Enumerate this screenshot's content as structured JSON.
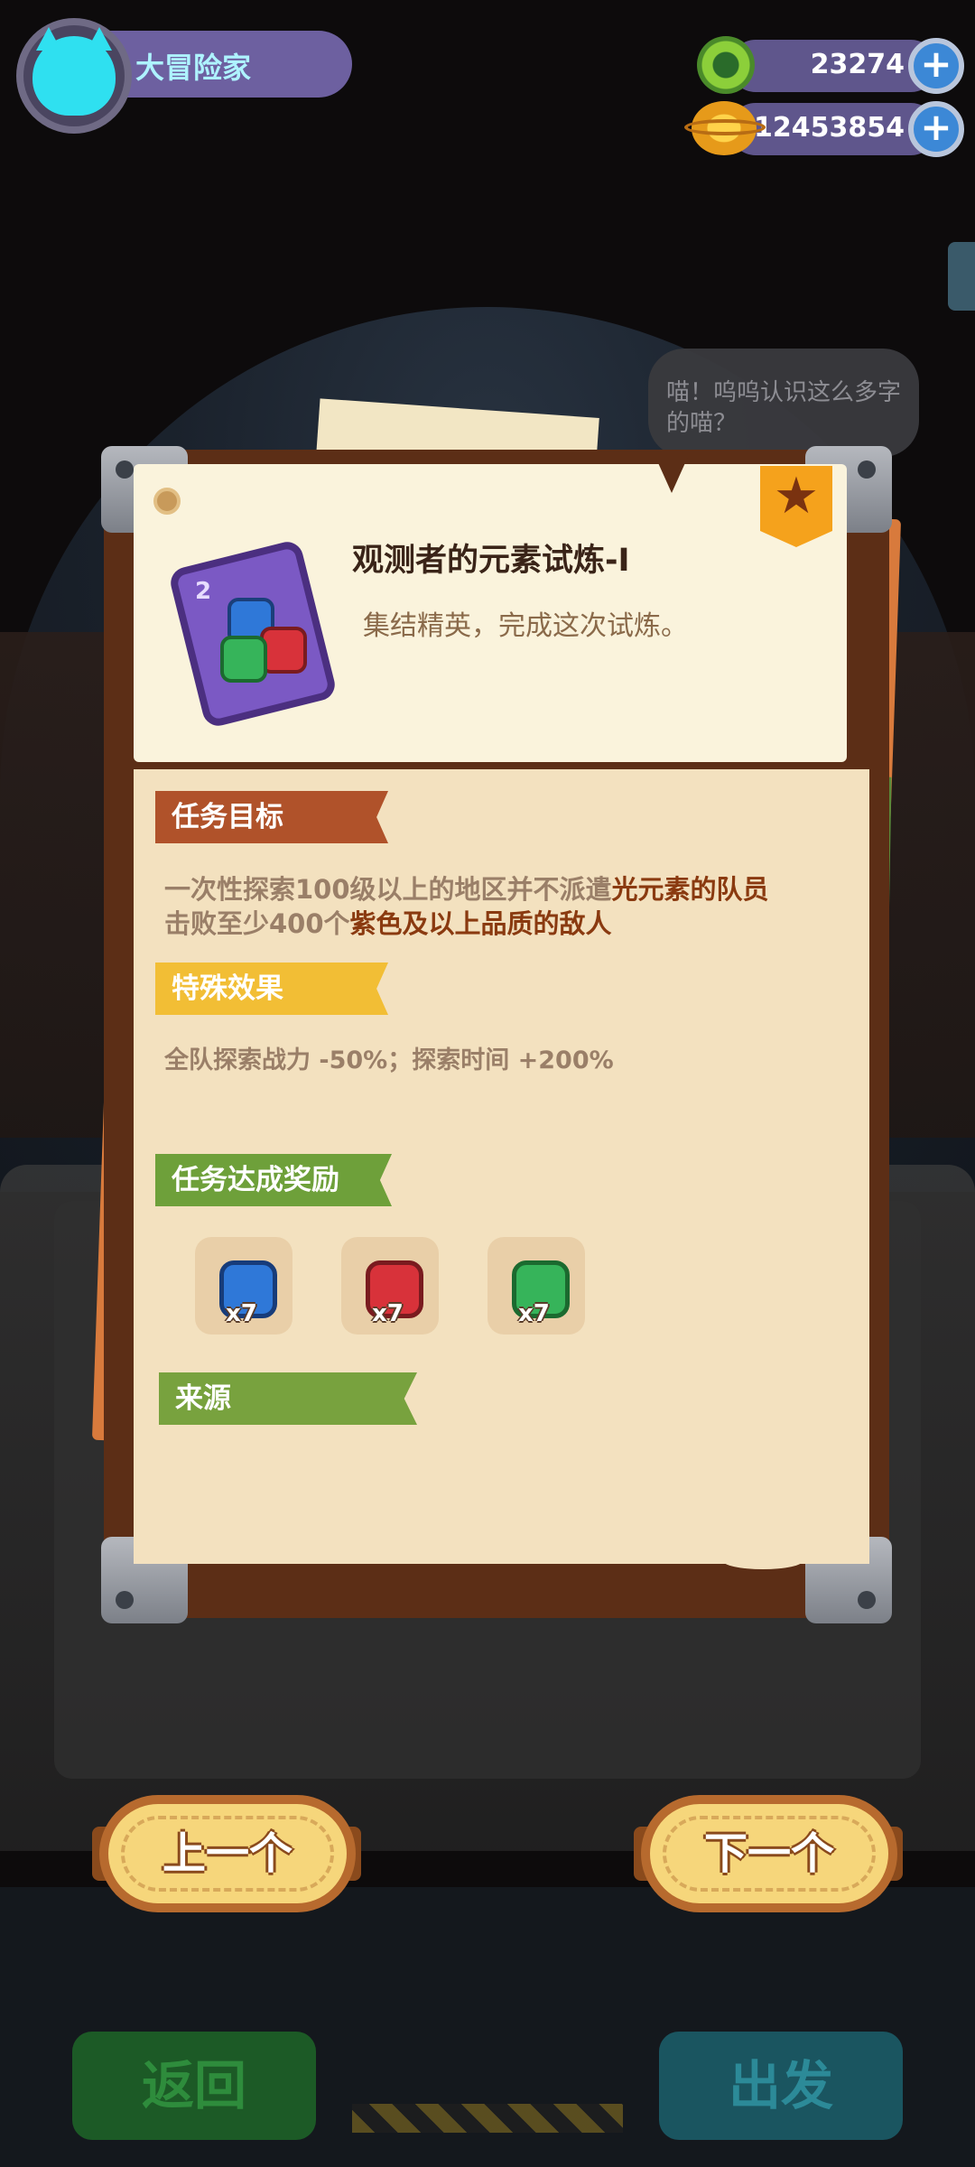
{
  "hud": {
    "player_name": "大冒险家",
    "green_currency": "23274",
    "gold_currency": "12453854",
    "plus": "+"
  },
  "speech_bubble": "喵！呜呜认识这么多字的喵？",
  "quest": {
    "title": "观测者的元素试炼-I",
    "subtitle": "集结精英，完成这次试炼。",
    "card_number": "2",
    "objective_label": "任务目标",
    "objective_line1_prefix": "一次性探索100级以上的地区并不派遣",
    "objective_line1_highlight": "光元素的队员",
    "objective_line2_prefix": "击败至少400个",
    "objective_line2_highlight": "紫色及以上品质的敌人",
    "effect_label": "特殊效果",
    "effect_text": "全队探索战力 -50%；探索时间 +200%",
    "reward_label": "任务达成奖励",
    "rewards": [
      {
        "gem": "blue-gem-icon",
        "qty": "x7",
        "color": "#2f78d8"
      },
      {
        "gem": "red-gem-icon",
        "qty": "x7",
        "color": "#d8323a"
      },
      {
        "gem": "green-gem-icon",
        "qty": "x7",
        "color": "#36b45a"
      }
    ],
    "source_label": "来源"
  },
  "nav": {
    "prev": "上一个",
    "next": "下一个"
  },
  "bottom": {
    "back": "返回",
    "go": "出发"
  },
  "colors": {
    "accent_orange": "#b0522a",
    "accent_yellow": "#f2be35",
    "accent_green": "#6ea03a",
    "button_fill": "#f6d67b",
    "button_border": "#b76a2e"
  }
}
